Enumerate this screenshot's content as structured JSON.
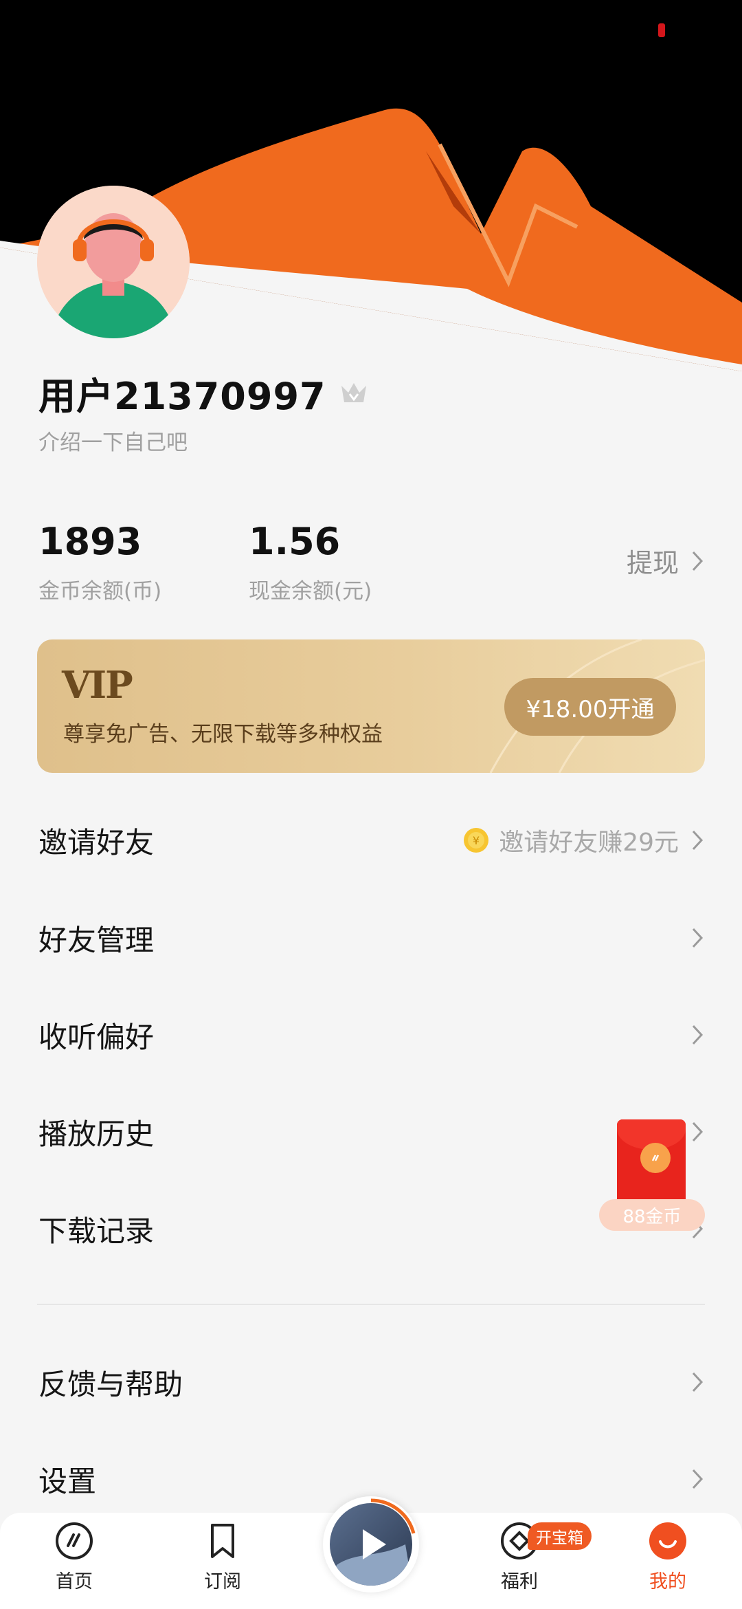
{
  "profile": {
    "username": "用户21370997",
    "bio": "介绍一下自己吧"
  },
  "stats": {
    "coins": {
      "value": "1893",
      "label": "金币余额(币)"
    },
    "cash": {
      "value": "1.56",
      "label": "现金余额(元)"
    },
    "withdraw_label": "提现"
  },
  "vip": {
    "title": "VIP",
    "description": "尊享免广告、无限下载等多种权益",
    "button": "¥18.00开通"
  },
  "menu": {
    "invite": {
      "label": "邀请好友",
      "hint": "邀请好友赚29元"
    },
    "friends": {
      "label": "好友管理"
    },
    "preferences": {
      "label": "收听偏好"
    },
    "history": {
      "label": "播放历史"
    },
    "downloads": {
      "label": "下载记录"
    },
    "feedback": {
      "label": "反馈与帮助"
    },
    "settings": {
      "label": "设置"
    }
  },
  "red_packet": {
    "label": "88金币"
  },
  "tabbar": {
    "home": "首页",
    "subscribe": "订阅",
    "welfare": "福利",
    "welfare_badge": "开宝箱",
    "mine": "我的"
  },
  "colors": {
    "accent": "#f04f20",
    "vip_gold": "#c19a62",
    "header_black": "#000000",
    "header_orange": "#f06a1e"
  }
}
